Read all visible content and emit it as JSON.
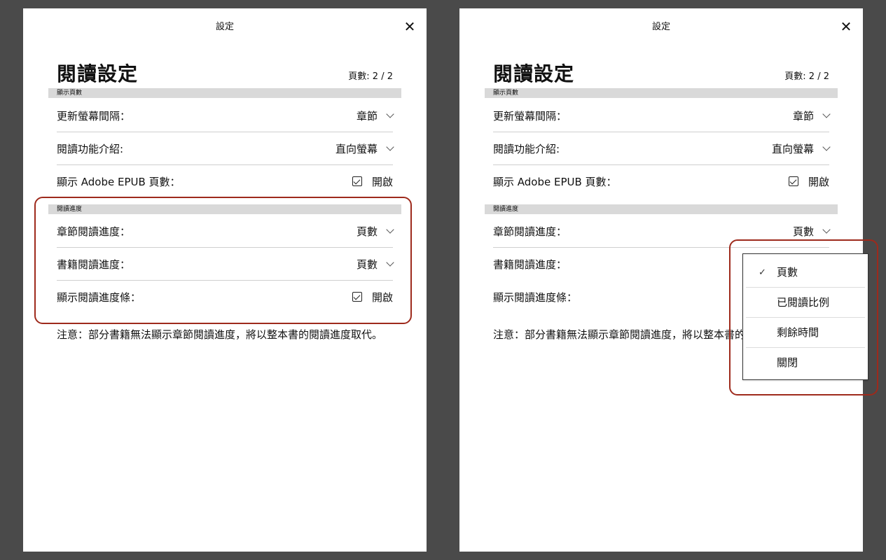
{
  "left": {
    "title": "設定",
    "heading": "閱讀設定",
    "page_count": "頁數: 2 / 2",
    "section1": "顯示頁數",
    "rows1": [
      {
        "label": "更新螢幕間隔：",
        "value": "章節"
      },
      {
        "label": "閱讀功能介紹:",
        "value": "直向螢幕"
      },
      {
        "label": "顯示 Adobe EPUB 頁數：",
        "value": "開啟"
      }
    ],
    "section2": "閱讀進度",
    "rows2": [
      {
        "label": "章節閱讀進度：",
        "value": "頁數"
      },
      {
        "label": "書籍閱讀進度：",
        "value": "頁數"
      },
      {
        "label": "顯示閱讀進度條：",
        "value": "開啟"
      }
    ],
    "note": "注意：部分書籍無法顯示章節閱讀進度，將以整本書的閱讀進度取代。"
  },
  "right": {
    "title": "設定",
    "heading": "閱讀設定",
    "page_count": "頁數: 2 / 2",
    "section1": "顯示頁數",
    "rows1": [
      {
        "label": "更新螢幕間隔：",
        "value": "章節"
      },
      {
        "label": "閱讀功能介紹:",
        "value": "直向螢幕"
      },
      {
        "label": "顯示 Adobe EPUB 頁數：",
        "value": "開啟"
      }
    ],
    "section2": "閱讀進度",
    "rows2": [
      {
        "label": "章節閱讀進度：",
        "value": "頁數"
      },
      {
        "label": "書籍閱讀進度："
      },
      {
        "label": "顯示閱讀進度條："
      }
    ],
    "note": "注意：部分書籍無法顯示章節閱讀進度，將以整本書的閱讀進度取代。",
    "dropdown": [
      {
        "label": "頁數",
        "checked": true
      },
      {
        "label": "已閱讀比例"
      },
      {
        "label": "剩餘時間"
      },
      {
        "label": "關閉"
      }
    ]
  },
  "icons": {
    "close": "close-icon",
    "chevron": "chevron-down-icon",
    "checkbox": "checkbox-checked-icon",
    "check": "checkmark-icon"
  },
  "colors": {
    "background": "#4a4a4a",
    "highlight": "#9e2a1c",
    "section_bg": "#d9d9d9"
  }
}
